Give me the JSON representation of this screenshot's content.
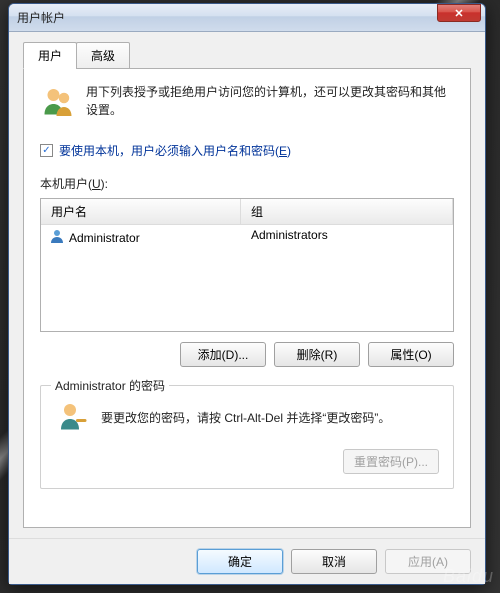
{
  "window": {
    "title": "用户帐户"
  },
  "tabs": {
    "user": "用户",
    "advanced": "高级"
  },
  "intro": "用下列表授予或拒绝用户访问您的计算机，还可以更改其密码和其他设置。",
  "checkbox": {
    "checked": "✓",
    "label_pre": "要使用本机，用户必须输入用户名和密码(",
    "label_key": "E",
    "label_post": ")"
  },
  "local_users_label": {
    "pre": "本机用户(",
    "key": "U",
    "post": "):"
  },
  "table": {
    "headers": {
      "user": "用户名",
      "group": "组"
    },
    "rows": [
      {
        "user": "Administrator",
        "group": "Administrators"
      }
    ]
  },
  "buttons": {
    "add": "添加(D)...",
    "remove": "删除(R)",
    "props": "属性(O)"
  },
  "password_box": {
    "legend": "Administrator 的密码",
    "text": "要更改您的密码，请按 Ctrl-Alt-Del 并选择“更改密码”。",
    "reset": "重置密码(P)..."
  },
  "footer": {
    "ok": "确定",
    "cancel": "取消",
    "apply": "应用(A)"
  },
  "watermark": "Baidu"
}
